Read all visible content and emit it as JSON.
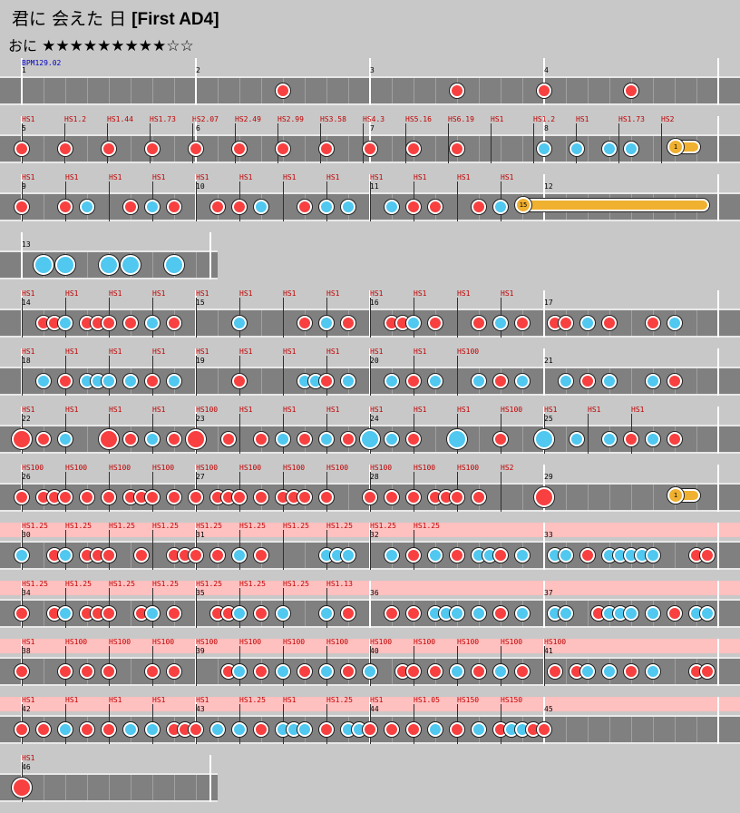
{
  "song": {
    "title": "君に 会えた 日",
    "title_suffix": "[First AD4]"
  },
  "difficulty": {
    "label": "おに",
    "stars_filled": "★★★★★★★★★",
    "stars_empty": "☆☆",
    "level": 9
  },
  "bpm_label": "BPM129.02",
  "colors": {
    "don": "#f84040",
    "ka": "#50c8f0",
    "roll": "#f0b030",
    "lane": "#808080",
    "gogo_band": "#ffc0c0"
  },
  "rows": [
    {
      "measures": [
        "1",
        "2",
        "3",
        "4"
      ],
      "notes": [
        [
          312,
          "d"
        ],
        [
          504,
          "d"
        ],
        [
          600,
          "d"
        ],
        [
          696,
          "d"
        ]
      ],
      "hs": []
    },
    {
      "measures": [
        "5",
        "6",
        "7",
        "8"
      ],
      "notes": [
        [
          24,
          "d"
        ],
        [
          72,
          "d"
        ],
        [
          120,
          "d"
        ],
        [
          168,
          "d"
        ],
        [
          216,
          "d"
        ],
        [
          264,
          "d"
        ],
        [
          312,
          "d"
        ],
        [
          360,
          "d"
        ],
        [
          408,
          "d"
        ],
        [
          456,
          "d"
        ],
        [
          504,
          "d"
        ],
        [
          600,
          "k"
        ],
        [
          636,
          "k"
        ],
        [
          672,
          "k"
        ],
        [
          696,
          "k"
        ]
      ],
      "hs": [
        "HS1",
        "HS1.2",
        "HS1.44",
        "HS1.73",
        "HS2.07",
        "HS2.49",
        "HS2.99",
        "HS3.58",
        "HS4.3",
        "HS5.16",
        "HS6.19",
        "HS1",
        "HS1.2",
        "HS1",
        "HS1.73",
        "HS2"
      ],
      "roll": [
        "1",
        744,
        764
      ]
    },
    {
      "measures": [
        "9",
        "10",
        "11",
        "12"
      ],
      "notes": [
        [
          24,
          "d"
        ],
        [
          72,
          "d"
        ],
        [
          96,
          "k"
        ],
        [
          144,
          "d"
        ],
        [
          168,
          "k"
        ],
        [
          192,
          "d"
        ],
        [
          240,
          "d"
        ],
        [
          264,
          "d"
        ],
        [
          288,
          "k"
        ],
        [
          336,
          "d"
        ],
        [
          360,
          "k"
        ],
        [
          384,
          "k"
        ],
        [
          432,
          "k"
        ],
        [
          456,
          "d"
        ],
        [
          480,
          "d"
        ],
        [
          528,
          "d"
        ],
        [
          552,
          "k"
        ]
      ],
      "hs": [
        "HS1",
        "HS1",
        "HS1",
        "HS1",
        "HS1",
        "HS1",
        "HS1",
        "HS1",
        "HS1",
        "HS1",
        "HS1",
        "HS1"
      ],
      "roll": [
        "15",
        576,
        774
      ]
    },
    {
      "measures": [
        "13"
      ],
      "notes": [
        [
          48,
          "K"
        ],
        [
          72,
          "K"
        ],
        [
          120,
          "K"
        ],
        [
          144,
          "K"
        ],
        [
          192,
          "K"
        ]
      ],
      "hs": []
    },
    {
      "measures": [
        "14",
        "15",
        "16",
        "17"
      ],
      "notes": [
        [
          48,
          "d"
        ],
        [
          60,
          "d"
        ],
        [
          72,
          "k"
        ],
        [
          96,
          "d"
        ],
        [
          108,
          "d"
        ],
        [
          120,
          "d"
        ],
        [
          144,
          "d"
        ],
        [
          168,
          "k"
        ],
        [
          192,
          "d"
        ],
        [
          264,
          "k"
        ],
        [
          336,
          "d"
        ],
        [
          360,
          "k"
        ],
        [
          384,
          "d"
        ],
        [
          432,
          "d"
        ],
        [
          444,
          "d"
        ],
        [
          456,
          "k"
        ],
        [
          480,
          "d"
        ],
        [
          528,
          "d"
        ],
        [
          552,
          "k"
        ],
        [
          576,
          "d"
        ],
        [
          612,
          "d"
        ],
        [
          624,
          "d"
        ],
        [
          648,
          "k"
        ],
        [
          672,
          "d"
        ],
        [
          720,
          "d"
        ],
        [
          744,
          "k"
        ]
      ],
      "hs": [
        "HS1",
        "HS1",
        "HS1",
        "HS1",
        "HS1",
        "HS1",
        "HS1",
        "HS1",
        "HS1",
        "HS1",
        "HS1",
        "HS1"
      ]
    },
    {
      "measures": [
        "18",
        "19",
        "20",
        "21"
      ],
      "notes": [
        [
          48,
          "k"
        ],
        [
          72,
          "d"
        ],
        [
          96,
          "k"
        ],
        [
          108,
          "k"
        ],
        [
          120,
          "k"
        ],
        [
          144,
          "k"
        ],
        [
          168,
          "d"
        ],
        [
          192,
          "k"
        ],
        [
          264,
          "d"
        ],
        [
          336,
          "k"
        ],
        [
          348,
          "k"
        ],
        [
          360,
          "d"
        ],
        [
          384,
          "k"
        ],
        [
          432,
          "k"
        ],
        [
          456,
          "d"
        ],
        [
          480,
          "k"
        ],
        [
          528,
          "k"
        ],
        [
          552,
          "d"
        ],
        [
          576,
          "k"
        ],
        [
          624,
          "k"
        ],
        [
          648,
          "d"
        ],
        [
          672,
          "k"
        ],
        [
          720,
          "k"
        ],
        [
          744,
          "d"
        ]
      ],
      "hs": [
        "HS1",
        "HS1",
        "HS1",
        "HS1",
        "HS1",
        "HS1",
        "HS1",
        "HS1",
        "HS1",
        "HS1",
        "HS100"
      ]
    },
    {
      "measures": [
        "22",
        "23",
        "24",
        "25"
      ],
      "notes": [
        [
          24,
          "D"
        ],
        [
          48,
          "d"
        ],
        [
          72,
          "k"
        ],
        [
          120,
          "D"
        ],
        [
          144,
          "d"
        ],
        [
          168,
          "k"
        ],
        [
          192,
          "d"
        ],
        [
          216,
          "D"
        ],
        [
          252,
          "d"
        ],
        [
          288,
          "d"
        ],
        [
          312,
          "k"
        ],
        [
          336,
          "d"
        ],
        [
          360,
          "k"
        ],
        [
          384,
          "d"
        ],
        [
          408,
          "K"
        ],
        [
          432,
          "k"
        ],
        [
          456,
          "d"
        ],
        [
          504,
          "K"
        ],
        [
          552,
          "d"
        ],
        [
          600,
          "K"
        ],
        [
          636,
          "k"
        ],
        [
          672,
          "k"
        ],
        [
          696,
          "d"
        ],
        [
          720,
          "k"
        ],
        [
          744,
          "d"
        ]
      ],
      "hs": [
        "HS1",
        "HS1",
        "HS1",
        "HS1",
        "HS100",
        "HS1",
        "HS1",
        "HS1",
        "HS1",
        "HS1",
        "HS1",
        "HS100",
        "HS1",
        "HS1",
        "HS1"
      ]
    },
    {
      "measures": [
        "26",
        "27",
        "28",
        "29"
      ],
      "notes": [
        [
          24,
          "d"
        ],
        [
          48,
          "d"
        ],
        [
          60,
          "d"
        ],
        [
          72,
          "d"
        ],
        [
          96,
          "d"
        ],
        [
          120,
          "d"
        ],
        [
          144,
          "d"
        ],
        [
          156,
          "d"
        ],
        [
          168,
          "d"
        ],
        [
          192,
          "d"
        ],
        [
          216,
          "d"
        ],
        [
          240,
          "d"
        ],
        [
          252,
          "d"
        ],
        [
          264,
          "d"
        ],
        [
          288,
          "d"
        ],
        [
          312,
          "d"
        ],
        [
          324,
          "d"
        ],
        [
          336,
          "d"
        ],
        [
          360,
          "d"
        ],
        [
          408,
          "d"
        ],
        [
          432,
          "d"
        ],
        [
          456,
          "d"
        ],
        [
          480,
          "d"
        ],
        [
          492,
          "d"
        ],
        [
          504,
          "d"
        ],
        [
          528,
          "d"
        ],
        [
          600,
          "D"
        ]
      ],
      "hs": [
        "HS100",
        "HS100",
        "HS100",
        "HS100",
        "HS100",
        "HS100",
        "HS100",
        "HS100",
        "HS100",
        "HS100",
        "HS100",
        "HS2"
      ],
      "roll": [
        "1",
        744,
        764
      ]
    },
    {
      "measures": [
        "30",
        "31",
        "32",
        "33"
      ],
      "gogo": true,
      "notes": [
        [
          24,
          "k"
        ],
        [
          60,
          "d"
        ],
        [
          72,
          "k"
        ],
        [
          96,
          "d"
        ],
        [
          108,
          "d"
        ],
        [
          120,
          "d"
        ],
        [
          156,
          "d"
        ],
        [
          192,
          "d"
        ],
        [
          204,
          "d"
        ],
        [
          216,
          "d"
        ],
        [
          240,
          "d"
        ],
        [
          264,
          "k"
        ],
        [
          288,
          "d"
        ],
        [
          360,
          "k"
        ],
        [
          372,
          "k"
        ],
        [
          384,
          "k"
        ],
        [
          432,
          "k"
        ],
        [
          456,
          "d"
        ],
        [
          480,
          "k"
        ],
        [
          504,
          "d"
        ],
        [
          528,
          "k"
        ],
        [
          540,
          "k"
        ],
        [
          552,
          "d"
        ],
        [
          576,
          "k"
        ],
        [
          612,
          "k"
        ],
        [
          624,
          "k"
        ],
        [
          648,
          "d"
        ],
        [
          672,
          "k"
        ],
        [
          684,
          "k"
        ],
        [
          696,
          "k"
        ],
        [
          708,
          "k"
        ],
        [
          720,
          "k"
        ],
        [
          768,
          "d"
        ],
        [
          780,
          "d"
        ]
      ],
      "hs": [
        "HS1.25",
        "HS1.25",
        "HS1.25",
        "HS1.25",
        "HS1.25",
        "HS1.25",
        "HS1.25",
        "HS1.25",
        "HS1.25",
        "HS1.25"
      ]
    },
    {
      "measures": [
        "34",
        "35",
        "36",
        "37"
      ],
      "gogo": true,
      "notes": [
        [
          24,
          "d"
        ],
        [
          60,
          "d"
        ],
        [
          72,
          "k"
        ],
        [
          96,
          "d"
        ],
        [
          108,
          "d"
        ],
        [
          120,
          "d"
        ],
        [
          156,
          "d"
        ],
        [
          168,
          "k"
        ],
        [
          192,
          "d"
        ],
        [
          240,
          "d"
        ],
        [
          252,
          "d"
        ],
        [
          264,
          "k"
        ],
        [
          288,
          "d"
        ],
        [
          312,
          "k"
        ],
        [
          360,
          "k"
        ],
        [
          384,
          "d"
        ],
        [
          432,
          "d"
        ],
        [
          456,
          "d"
        ],
        [
          480,
          "k"
        ],
        [
          492,
          "k"
        ],
        [
          504,
          "k"
        ],
        [
          528,
          "k"
        ],
        [
          552,
          "d"
        ],
        [
          576,
          "k"
        ],
        [
          612,
          "k"
        ],
        [
          624,
          "k"
        ],
        [
          660,
          "d"
        ],
        [
          672,
          "k"
        ],
        [
          684,
          "k"
        ],
        [
          696,
          "k"
        ],
        [
          720,
          "k"
        ],
        [
          744,
          "d"
        ],
        [
          768,
          "k"
        ],
        [
          780,
          "k"
        ]
      ],
      "hs": [
        "HS1.25",
        "HS1.25",
        "HS1.25",
        "HS1.25",
        "HS1.25",
        "HS1.25",
        "HS1.25",
        "HS1.13"
      ]
    },
    {
      "measures": [
        "38",
        "39",
        "40",
        "41"
      ],
      "gogo": true,
      "notes": [
        [
          24,
          "d"
        ],
        [
          72,
          "d"
        ],
        [
          96,
          "d"
        ],
        [
          120,
          "d"
        ],
        [
          168,
          "d"
        ],
        [
          192,
          "d"
        ],
        [
          252,
          "d"
        ],
        [
          264,
          "k"
        ],
        [
          288,
          "d"
        ],
        [
          312,
          "k"
        ],
        [
          336,
          "d"
        ],
        [
          360,
          "k"
        ],
        [
          384,
          "d"
        ],
        [
          408,
          "k"
        ],
        [
          444,
          "d"
        ],
        [
          456,
          "d"
        ],
        [
          480,
          "d"
        ],
        [
          504,
          "k"
        ],
        [
          528,
          "d"
        ],
        [
          552,
          "k"
        ],
        [
          576,
          "d"
        ],
        [
          612,
          "d"
        ],
        [
          636,
          "d"
        ],
        [
          648,
          "k"
        ],
        [
          672,
          "k"
        ],
        [
          696,
          "d"
        ],
        [
          720,
          "k"
        ],
        [
          768,
          "d"
        ],
        [
          780,
          "d"
        ]
      ],
      "hs": [
        "HS1",
        "HS100",
        "HS100",
        "HS100",
        "HS100",
        "HS100",
        "HS100",
        "HS100",
        "HS100",
        "HS100",
        "HS100",
        "HS100",
        "HS100"
      ]
    },
    {
      "measures": [
        "42",
        "43",
        "44",
        "45"
      ],
      "gogo": true,
      "notes": [
        [
          24,
          "d"
        ],
        [
          48,
          "d"
        ],
        [
          72,
          "k"
        ],
        [
          96,
          "d"
        ],
        [
          120,
          "d"
        ],
        [
          144,
          "k"
        ],
        [
          168,
          "k"
        ],
        [
          192,
          "d"
        ],
        [
          204,
          "d"
        ],
        [
          216,
          "d"
        ],
        [
          240,
          "k"
        ],
        [
          264,
          "k"
        ],
        [
          288,
          "d"
        ],
        [
          312,
          "k"
        ],
        [
          324,
          "k"
        ],
        [
          336,
          "k"
        ],
        [
          360,
          "d"
        ],
        [
          384,
          "k"
        ],
        [
          396,
          "k"
        ],
        [
          408,
          "d"
        ],
        [
          432,
          "d"
        ],
        [
          456,
          "d"
        ],
        [
          480,
          "k"
        ],
        [
          504,
          "d"
        ],
        [
          528,
          "k"
        ],
        [
          552,
          "d"
        ],
        [
          564,
          "k"
        ],
        [
          576,
          "k"
        ],
        [
          588,
          "d"
        ],
        [
          600,
          "d"
        ]
      ],
      "hs": [
        "HS1",
        "HS1",
        "HS1",
        "HS1",
        "HS1",
        "HS1.25",
        "HS1",
        "HS1.25",
        "HS1",
        "HS1.05",
        "HS150",
        "HS150"
      ]
    },
    {
      "measures": [
        "46"
      ],
      "notes": [
        [
          24,
          "D"
        ]
      ],
      "hs": [
        "HS1"
      ]
    }
  ]
}
